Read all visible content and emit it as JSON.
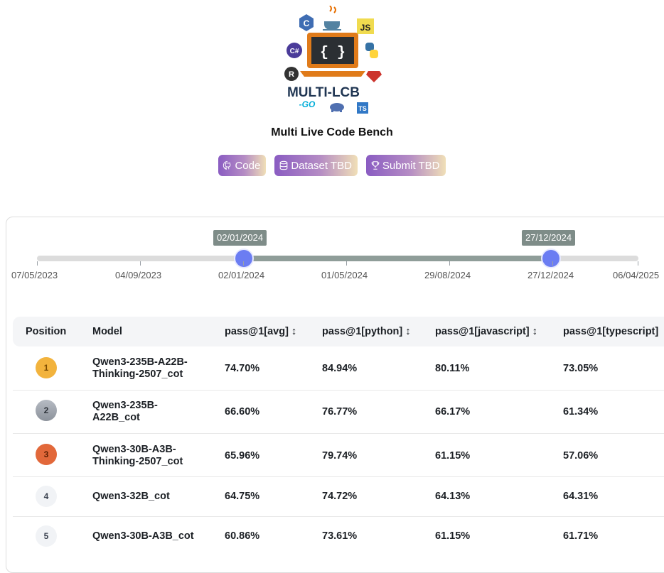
{
  "logo": {
    "wordmark": "MULTI-LCB",
    "language_icons": [
      "c-icon",
      "java-icon",
      "js-icon",
      "csharp-icon",
      "python-icon",
      "rust-icon",
      "ruby-icon",
      "go-icon",
      "php-icon",
      "ts-icon"
    ]
  },
  "header": {
    "title": "Multi Live Code Bench"
  },
  "buttons": [
    {
      "label": "Code",
      "icon": "github-icon"
    },
    {
      "label": "Dataset TBD",
      "icon": "database-icon"
    },
    {
      "label": "Submit TBD",
      "icon": "trophy-icon"
    }
  ],
  "slider": {
    "start_label": "02/01/2024",
    "end_label": "27/12/2024",
    "ticks": [
      "07/05/2023",
      "04/09/2023",
      "02/01/2024",
      "01/05/2024",
      "29/08/2024",
      "27/12/2024",
      "06/04/2025"
    ]
  },
  "table": {
    "columns": [
      "Position",
      "Model",
      "pass@1[avg] ↕",
      "pass@1[python] ↕",
      "pass@1[javascript] ↕",
      "pass@1[typescript]"
    ],
    "rows": [
      {
        "position": "1",
        "model": "Qwen3-235B-A22B-Thinking-2507_cot",
        "avg": "74.70%",
        "python": "84.94%",
        "javascript": "80.11%",
        "typescript": "73.05%"
      },
      {
        "position": "2",
        "model": "Qwen3-235B-A22B_cot",
        "avg": "66.60%",
        "python": "76.77%",
        "javascript": "66.17%",
        "typescript": "61.34%"
      },
      {
        "position": "3",
        "model": "Qwen3-30B-A3B-Thinking-2507_cot",
        "avg": "65.96%",
        "python": "79.74%",
        "javascript": "61.15%",
        "typescript": "57.06%"
      },
      {
        "position": "4",
        "model": "Qwen3-32B_cot",
        "avg": "64.75%",
        "python": "74.72%",
        "javascript": "64.13%",
        "typescript": "64.31%"
      },
      {
        "position": "5",
        "model": "Qwen3-30B-A3B_cot",
        "avg": "60.86%",
        "python": "73.61%",
        "javascript": "61.15%",
        "typescript": "61.71%"
      }
    ]
  },
  "colors": {
    "accent": "#6b7df2",
    "gold": "#f2b33d",
    "silver": "#9aa0aa",
    "bronze": "#e2683a"
  }
}
